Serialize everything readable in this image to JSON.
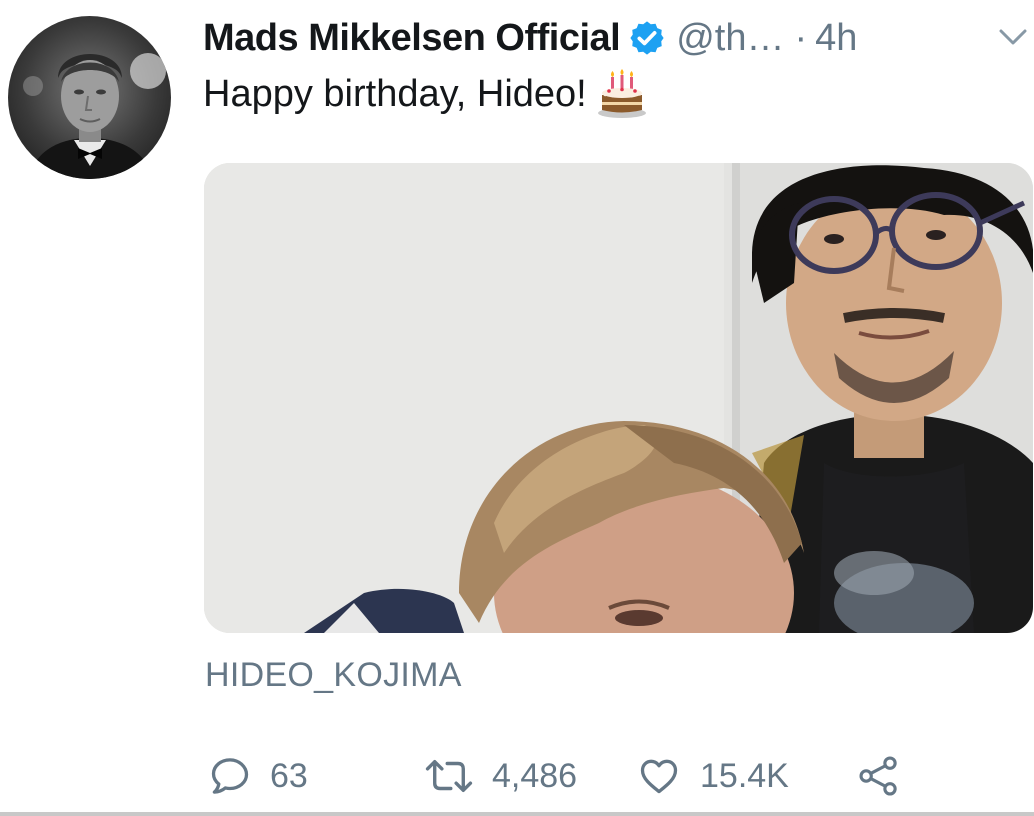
{
  "tweet": {
    "author": {
      "display_name": "Mads Mikkelsen Official",
      "handle": "@th…",
      "verified": true
    },
    "separator": "·",
    "time": "4h",
    "text": "Happy birthday, Hideo!",
    "emoji": "birthday-cake-icon",
    "media_credit": "HIDEO_KOJIMA"
  },
  "actions": {
    "reply_count": "63",
    "retweet_count": "4,486",
    "like_count": "15.4K"
  },
  "colors": {
    "text_primary": "#14171a",
    "text_secondary": "#657786",
    "verified_blue": "#1da1f2",
    "background": "#ffffff"
  },
  "icons": [
    "verified-badge-icon",
    "chevron-down-icon",
    "birthday-cake-icon",
    "reply-icon",
    "retweet-icon",
    "like-icon",
    "share-icon"
  ]
}
